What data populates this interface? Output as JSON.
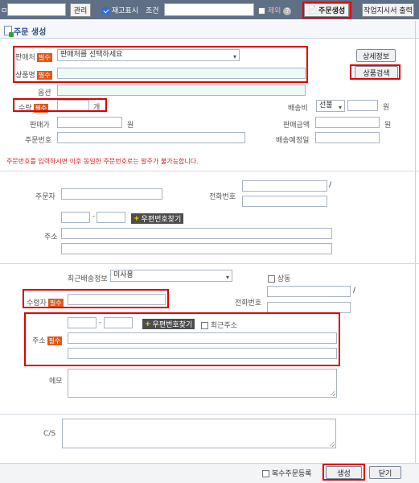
{
  "topbar": {
    "manage_label": "관리",
    "stock_display_label": "재고표시",
    "condition_label": "조건",
    "exclude_label": "제외",
    "create_order_label": "주문생성",
    "print_work_order_label": "작업지시서 출력",
    "left_glyph": "ㅁ"
  },
  "panel": {
    "title": "주문 생성"
  },
  "order": {
    "seller_label": "판매처",
    "required_badge": "필수",
    "seller_select_value": "판매처를 선택하세요",
    "detail_info_button": "상세정보",
    "product_name_label": "상품명",
    "product_search_button": "상품검색",
    "option_label": "옵션",
    "quantity_label": "수량",
    "quantity_unit": "개",
    "shipping_fee_label": "배송비",
    "shipping_fee_type": "선불",
    "won": "원",
    "sale_price_label": "판매가",
    "sale_amount_label": "판매금액",
    "order_number_label": "주문번호",
    "expected_ship_label": "배송예정일",
    "warning_text": "주문번호를 입력하시면 이후 동일한 주문번호로는 발주가 불가능합니다."
  },
  "orderer": {
    "orderer_label": "주문자",
    "phone_label": "전화번호",
    "slash": "/",
    "dash": "-",
    "postcode_button": "우편번호찾기",
    "address_label": "주소"
  },
  "recipient": {
    "recent_shipping_label": "최근배송정보",
    "recent_shipping_value": "미사용",
    "same_label": "상동",
    "recipient_label": "수령자",
    "phone_label": "전화번호",
    "slash": "/",
    "dash": "-",
    "postcode_button": "우편번호찾기",
    "recent_address_label": "최근주소",
    "address_label": "주소",
    "memo_label": "메모",
    "cs_label": "C/S"
  },
  "footer": {
    "multi_order_label": "복수주문등록",
    "create_button": "생성",
    "close_button": "닫기"
  },
  "colors": {
    "accent_red": "#e00000",
    "required_badge": "#e2581a",
    "topbar": "#5e6f86"
  }
}
